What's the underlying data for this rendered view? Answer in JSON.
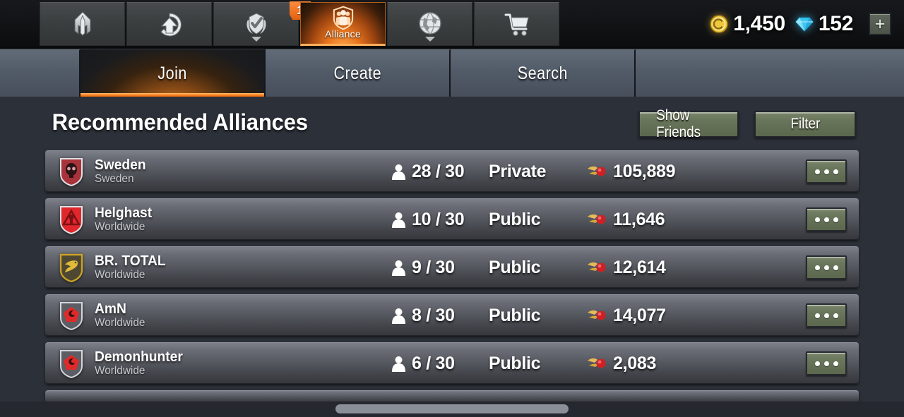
{
  "topnav": {
    "items": [
      {
        "icon": "rocket-icon",
        "label": "",
        "badge": null,
        "caret": false,
        "active": false
      },
      {
        "icon": "upgrade-arrow-icon",
        "label": "",
        "badge": null,
        "caret": false,
        "active": false
      },
      {
        "icon": "missions-wreath-check-icon",
        "label": "",
        "badge": "1",
        "caret": true,
        "active": false
      },
      {
        "icon": "alliance-shield-icon",
        "label": "Alliance",
        "badge": null,
        "caret": false,
        "active": true
      },
      {
        "icon": "globe-icon",
        "label": "",
        "badge": null,
        "caret": true,
        "active": false
      },
      {
        "icon": "shop-cart-icon",
        "label": "",
        "badge": null,
        "caret": false,
        "active": false
      }
    ],
    "currency": {
      "coin_icon": "gold-coin-icon",
      "coin_value": "1,450",
      "gem_icon": "blue-gem-icon",
      "gem_value": "152",
      "add_label": "+"
    }
  },
  "tabs": [
    {
      "label": "Join",
      "active": true
    },
    {
      "label": "Create",
      "active": false
    },
    {
      "label": "Search",
      "active": false
    }
  ],
  "page": {
    "title": "Recommended Alliances",
    "show_friends_label": "Show Friends",
    "filter_label": "Filter"
  },
  "colors": {
    "accent_orange": "#ff8a2b",
    "button_green": "#69755a",
    "header_bg": "#2c3038",
    "badge_orange": "#e4610f",
    "gem_blue": "#3fc6f0",
    "coin_gold": "#e8bd3c"
  },
  "icons": {
    "members": "member-silhouette-icon",
    "score": "red-comet-icon",
    "row_menu": "ellipsis-icon"
  },
  "alliances": [
    {
      "name": "Sweden",
      "region": "Sweden",
      "emblem": "skull-shield-red-icon",
      "members": "28 / 30",
      "privacy": "Private",
      "score": "105,889",
      "menu": "•••"
    },
    {
      "name": "Helghast",
      "region": "Worldwide",
      "emblem": "triangle-shield-red-icon",
      "members": "10 / 30",
      "privacy": "Public",
      "score": "11,646",
      "menu": "•••"
    },
    {
      "name": "BR. TOTAL",
      "region": "Worldwide",
      "emblem": "bird-shield-gold-icon",
      "members": "9 / 30",
      "privacy": "Public",
      "score": "12,614",
      "menu": "•••"
    },
    {
      "name": "AmN",
      "region": "Worldwide",
      "emblem": "claw-shield-gray-icon",
      "members": "8 / 30",
      "privacy": "Public",
      "score": "14,077",
      "menu": "•••"
    },
    {
      "name": "Demonhunter",
      "region": "Worldwide",
      "emblem": "claw-shield-gray-icon",
      "members": "6 / 30",
      "privacy": "Public",
      "score": "2,083",
      "menu": "•••"
    }
  ],
  "scroll": {
    "orientation": "horizontal"
  }
}
